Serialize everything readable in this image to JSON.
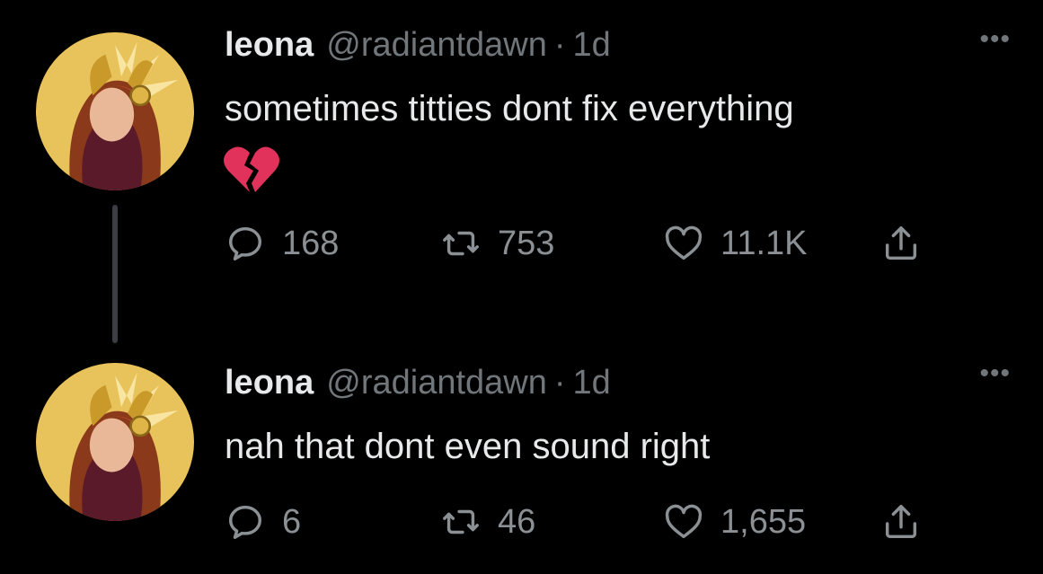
{
  "tweets": [
    {
      "name": "leona",
      "handle": "@radiantdawn",
      "separator": "·",
      "time": "1d",
      "text": "sometimes titties dont fix everything",
      "emoji": "broken-heart",
      "more": "•••",
      "replies": "168",
      "retweets": "753",
      "likes": "11.1K"
    },
    {
      "name": "leona",
      "handle": "@radiantdawn",
      "separator": "·",
      "time": "1d",
      "text": "nah that dont even sound right",
      "more": "•••",
      "replies": "6",
      "retweets": "46",
      "likes": "1,655"
    }
  ],
  "colors": {
    "background": "#000000",
    "text": "#e7e9ea",
    "secondary": "#71767b",
    "emoji": "#e0325a"
  }
}
